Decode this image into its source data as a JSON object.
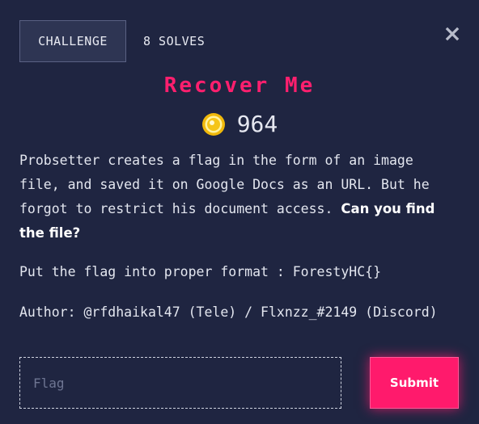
{
  "tabs": [
    {
      "label": "CHALLENGE",
      "active": true
    },
    {
      "label": "8 SOLVES",
      "active": false
    }
  ],
  "challenge": {
    "title": "Recover Me",
    "points": "964",
    "description_plain": "Probsetter creates a flag in the form of an image file, and saved it on Google Docs as an URL. But he forgot to restrict his document access. ",
    "description_bold": "Can you find the file?",
    "format_note": "Put the flag into proper format : ForestyHC{}",
    "author": "Author: @rfdhaikal47 (Tele) / Flxnzz_#2149 (Discord)"
  },
  "form": {
    "flag_placeholder": "Flag",
    "submit_label": "Submit"
  },
  "icons": {
    "close": "close-icon",
    "coin": "coin-icon"
  },
  "colors": {
    "background": "#1f2541",
    "accent": "#ff1a6c",
    "title": "#ff1f6e",
    "coin": "#f5c518"
  }
}
